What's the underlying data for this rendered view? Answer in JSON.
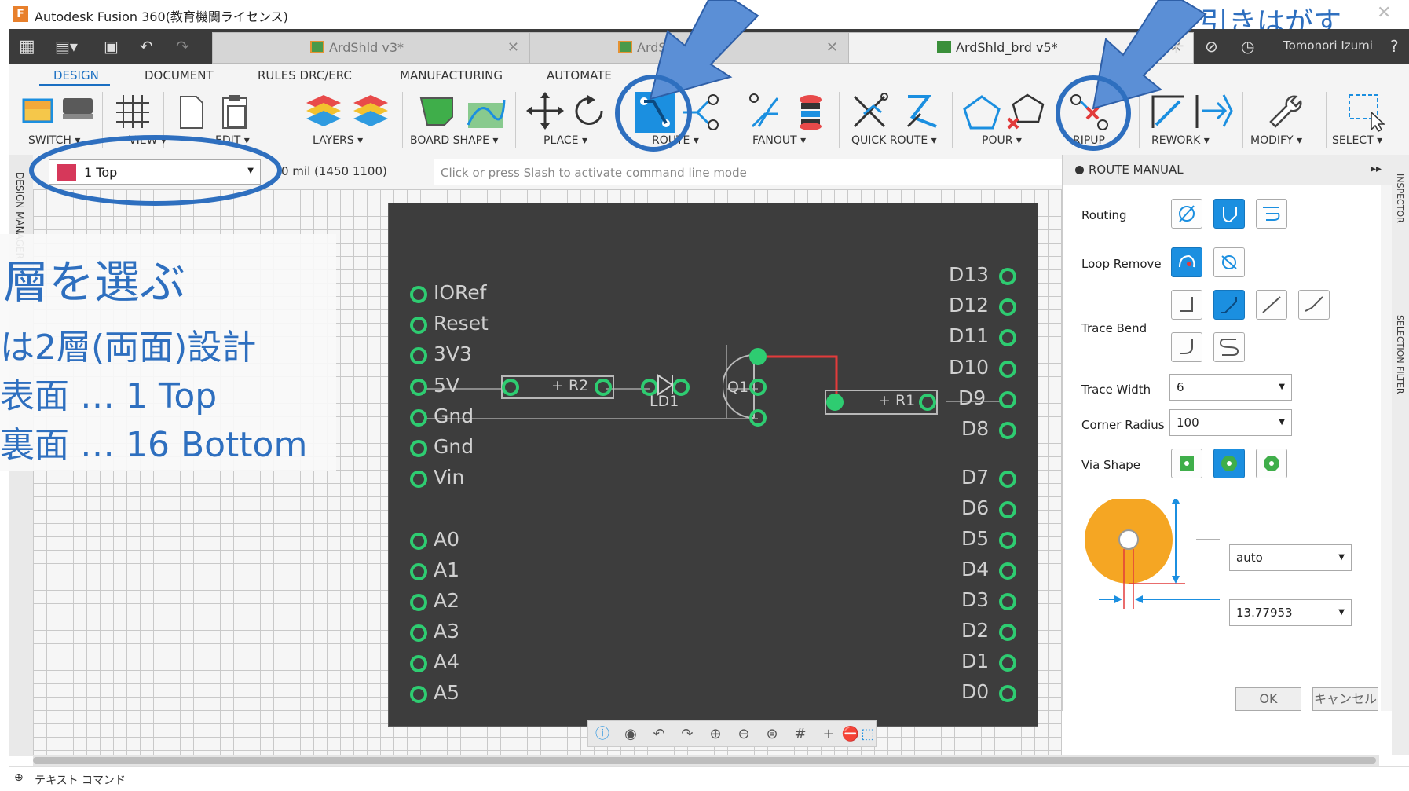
{
  "window": {
    "title": "Autodesk Fusion 360(教育機関ライセンス)",
    "app_icon": "F"
  },
  "tabs": [
    {
      "label": "ArdShld v3*",
      "active": false
    },
    {
      "label": "ArdShl",
      "suffix": "*",
      "active": false
    },
    {
      "label": "ArdShld_brd v5*",
      "active": true
    }
  ],
  "user": {
    "name": "Tomonori Izumi"
  },
  "ribbon_tabs": [
    "DESIGN",
    "DOCUMENT",
    "RULES DRC/ERC",
    "MANUFACTURING",
    "AUTOMATE",
    "LIBR"
  ],
  "tool_groups": [
    "SWITCH ▾",
    "VIEW ▾",
    "EDIT ▾",
    "LAYERS ▾",
    "BOARD SHAPE ▾",
    "PLACE ▾",
    "ROUTE ▾",
    "FANOUT ▾",
    "QUICK ROUTE ▾",
    "POUR ▾",
    "RIPUP",
    "REWORK ▾",
    "MODIFY ▾",
    "SELECT ▾"
  ],
  "layer": {
    "selected": "1 Top",
    "color": "#d6385a"
  },
  "coordinates": "0 mil (1450 1100)",
  "command_line": {
    "placeholder": "Click or press Slash to activate command line mode"
  },
  "left_strip": "DESIGN MANAGER",
  "overlay": {
    "heading": "層を選ぶ",
    "lines": [
      "は2層(両面)設計",
      "表面 … 1 Top",
      "裏面 … 16 Bottom"
    ]
  },
  "callout_top_right": "引きはがす",
  "board": {
    "left_pins": [
      "IORef",
      "Reset",
      "3V3",
      "5V",
      "Gnd",
      "Gnd",
      "Vin",
      "A0",
      "A1",
      "A2",
      "A3",
      "A4",
      "A5"
    ],
    "right_pins": [
      "D13",
      "D12",
      "D11",
      "D10",
      "D9",
      "D8",
      "D7",
      "D6",
      "D5",
      "D4",
      "D3",
      "D2",
      "D1",
      "D0"
    ],
    "parts": {
      "r2": "+ R2",
      "ld1": "LD1",
      "q1": "Q1",
      "r1": "+ R1"
    }
  },
  "panel": {
    "title": "ROUTE MANUAL",
    "routing_label": "Routing",
    "loop_remove_label": "Loop Remove",
    "trace_bend_label": "Trace Bend",
    "trace_width_label": "Trace Width",
    "trace_width_value": "6",
    "corner_radius_label": "Corner Radius",
    "corner_radius_value": "100",
    "via_shape_label": "Via Shape",
    "via_diameter_value": "auto",
    "via_drill_value": "13.77953",
    "ok_label": "OK",
    "cancel_label": "キャンセル"
  },
  "right_strip": {
    "inspector": "INSPECTOR",
    "selection_filter": "SELECTION FILTER"
  },
  "status_bar": {
    "text": "テキスト コマンド"
  },
  "colors": {
    "accent": "#1b8fe0",
    "callout": "#2e6fbf",
    "pad": "#2ecc71",
    "trace": "#e23b3b",
    "board": "#3d3d3d"
  }
}
